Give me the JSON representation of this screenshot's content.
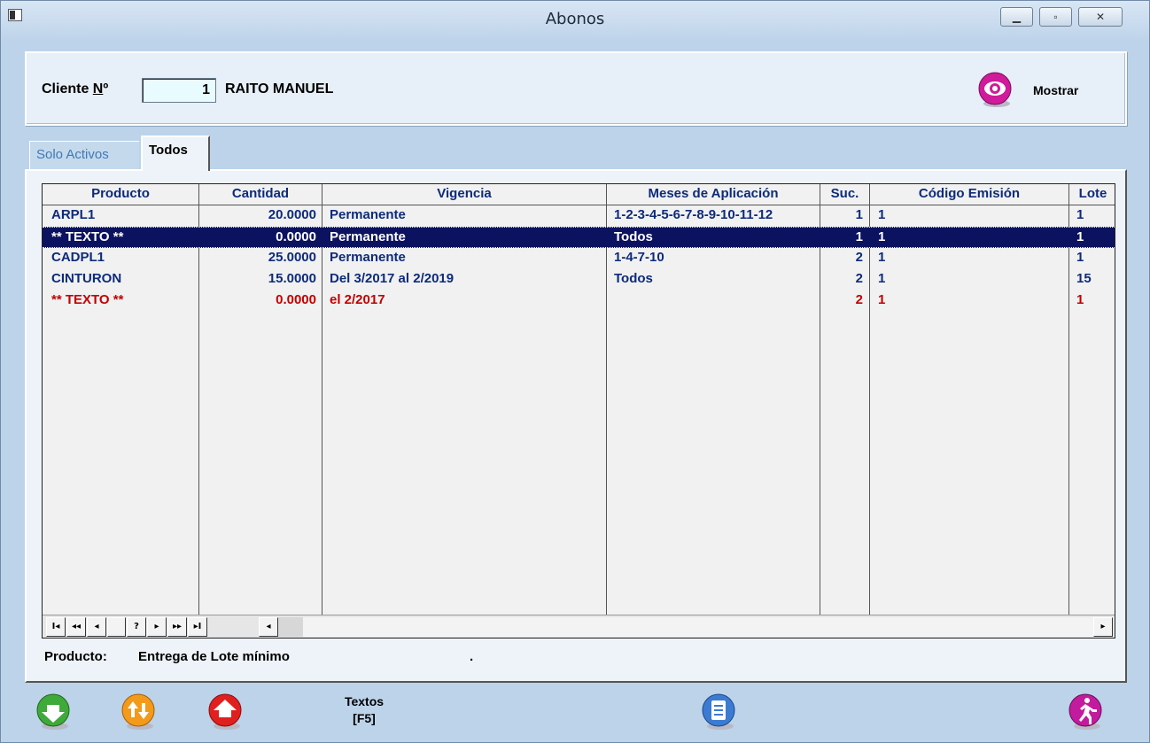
{
  "window": {
    "title": "Abonos"
  },
  "client": {
    "label_prefix": "Cliente ",
    "label_underlined": "N",
    "label_suffix": "º",
    "number": "1",
    "name": "RAITO MANUEL",
    "show_button_label": "Mostrar"
  },
  "tabs": [
    {
      "label": "Solo Activos",
      "active": false
    },
    {
      "label": "Todos",
      "active": true
    }
  ],
  "grid": {
    "columns": [
      "Producto",
      "Cantidad",
      "Vigencia",
      "Meses de Aplicación",
      "Suc.",
      "Código Emisión",
      "Lote"
    ],
    "rows": [
      {
        "producto": "ARPL1",
        "cantidad": "20.0000",
        "vigencia": "Permanente",
        "meses": "1-2-3-4-5-6-7-8-9-10-11-12",
        "suc": "1",
        "codigo": "1",
        "lote": "1",
        "state": "normal"
      },
      {
        "producto": "** TEXTO **",
        "cantidad": "0.0000",
        "vigencia": "Permanente",
        "meses": "Todos",
        "suc": "1",
        "codigo": "1",
        "lote": "1",
        "state": "selected"
      },
      {
        "producto": "CADPL1",
        "cantidad": "25.0000",
        "vigencia": "Permanente",
        "meses": "1-4-7-10",
        "suc": "2",
        "codigo": "1",
        "lote": "1",
        "state": "normal"
      },
      {
        "producto": "CINTURON",
        "cantidad": "15.0000",
        "vigencia": "Del 3/2017 al 2/2019",
        "meses": "Todos",
        "suc": "2",
        "codigo": "1",
        "lote": "15",
        "state": "normal"
      },
      {
        "producto": "** TEXTO **",
        "cantidad": "0.0000",
        "vigencia": "el 2/2017",
        "meses": "",
        "suc": "2",
        "codigo": "1",
        "lote": "1",
        "state": "inactive"
      }
    ],
    "nav_buttons": [
      "I◂",
      "◂◂",
      "◂",
      "?",
      "▸",
      "▸▸",
      "▸I"
    ]
  },
  "product_info": {
    "label": "Producto:",
    "value": "Entrega de Lote mínimo",
    "trailing": "."
  },
  "toolbar": {
    "textos_label": "Textos",
    "textos_shortcut": "[F5]"
  },
  "icons": {
    "down_arrow": "down-arrow-icon",
    "up_down_arrows": "up-down-arrows-icon",
    "up_arrow": "up-arrow-icon",
    "document": "document-icon",
    "exit": "walking-person-icon",
    "eye": "eye-icon"
  },
  "colors": {
    "selected_row_bg": "#0b1360",
    "normal_text": "#0d2b7a",
    "inactive_text": "#c10000",
    "green_button": "#3fa93a",
    "orange_button": "#f39a1b",
    "red_button": "#e0201e",
    "blue_button": "#3b7bd1",
    "magenta_button": "#c21b9e"
  }
}
